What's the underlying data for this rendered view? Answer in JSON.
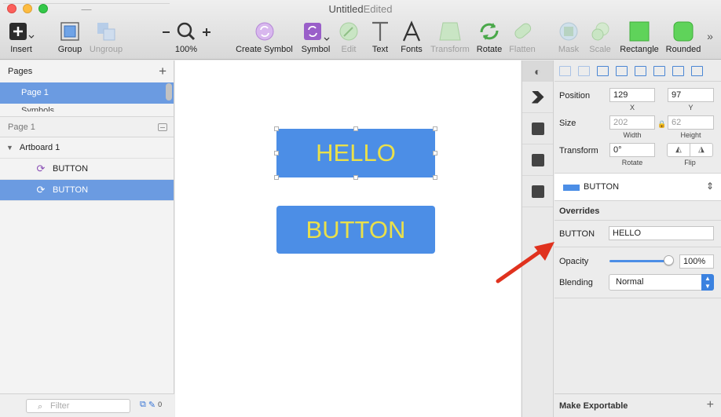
{
  "window": {
    "title": "Untitled",
    "separator": "—",
    "status": "Edited"
  },
  "toolbar": {
    "insert": "Insert",
    "group": "Group",
    "ungroup": "Ungroup",
    "zoom_value": "100%",
    "create_symbol": "Create Symbol",
    "symbol": "Symbol",
    "edit": "Edit",
    "text": "Text",
    "fonts": "Fonts",
    "transform": "Transform",
    "rotate": "Rotate",
    "flatten": "Flatten",
    "mask": "Mask",
    "scale": "Scale",
    "rectangle": "Rectangle",
    "rounded": "Rounded",
    "more": "»"
  },
  "pages": {
    "header": "Pages",
    "items": [
      {
        "label": "Page 1"
      },
      {
        "label": "Symbols"
      }
    ]
  },
  "layers": {
    "header": "Page 1",
    "artboard": "Artboard 1",
    "items": [
      {
        "label": "BUTTON"
      },
      {
        "label": "BUTTON"
      }
    ]
  },
  "filter": {
    "placeholder": "Filter",
    "count": "0"
  },
  "canvas": {
    "hello_text": "HELLO",
    "button_text": "BUTTON"
  },
  "inspector": {
    "position_label": "Position",
    "x_value": "129",
    "y_value": "97",
    "x_label": "X",
    "y_label": "Y",
    "size_label": "Size",
    "width_value": "202",
    "height_value": "62",
    "width_label": "Width",
    "height_label": "Height",
    "transform_label": "Transform",
    "rotate_value": "0°",
    "rotate_label": "Rotate",
    "flip_label": "Flip",
    "symbol_name": "BUTTON",
    "overrides_header": "Overrides",
    "override_label": "BUTTON",
    "override_value": "HELLO",
    "opacity_label": "Opacity",
    "opacity_value": "100%",
    "opacity_fraction": 1.0,
    "blending_label": "Blending",
    "blending_value": "Normal",
    "export_label": "Make Exportable"
  },
  "colors": {
    "accent": "#4c8ee6",
    "selection": "#6b9be1",
    "art_text": "#eae04a",
    "arrow": "#e0321e"
  }
}
